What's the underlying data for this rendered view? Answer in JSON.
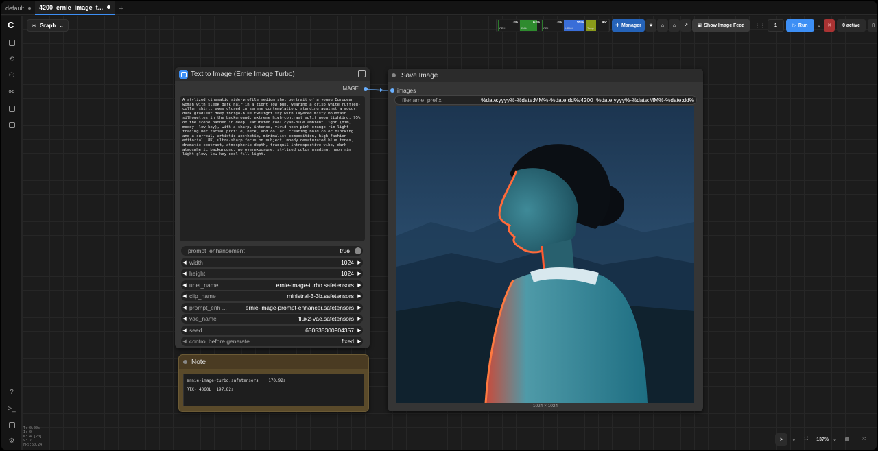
{
  "tabs": [
    {
      "label": "default",
      "active": false
    },
    {
      "label": "4200_ernie_image_t...",
      "active": true
    }
  ],
  "header": {
    "graph_label": "Graph"
  },
  "monitor": [
    {
      "label": "CPU",
      "value": "3%",
      "fill": 0.03,
      "color": "#2c7a2c"
    },
    {
      "label": "RAM",
      "value": "83%",
      "fill": 0.83,
      "color": "#2e8b2e"
    },
    {
      "label": "GPU",
      "value": "3%",
      "fill": 0.03,
      "color": "#2c7a2c"
    },
    {
      "label": "VRAM",
      "value": "95%",
      "fill": 0.95,
      "color": "#3a6ed8"
    },
    {
      "label": "Temp",
      "value": "46°",
      "fill": 0.46,
      "color": "#8a9a1a"
    }
  ],
  "toolbar": {
    "manager_label": "Manager",
    "image_feed_label": "Show Image Feed",
    "queue_count": "1",
    "run_label": "Run",
    "active_label": "0 active"
  },
  "text_node": {
    "title": "Text to Image (Ernie Image Turbo)",
    "output_label": "IMAGE",
    "prompt": "A stylized cinematic side-profile medium shot portrait of a young European woman with sleek dark hair in a tight low bun, wearing a crisp white ruffled-collar shirt, eyes closed in serene contemplation, standing against a moody, dark gradient deep indigo-blue twilight sky with layered misty mountain silhouettes in the background. extreme high-contrast split neon lighting: 95% of the scene bathed in deep, saturated cool cyan-blue ambient light (dim, moody, low-key), with a sharp, intense, vivid neon pink-orange rim light tracing her facial profile, neck, and collar, creating bold color blocking and a surreal, artistic aesthetic, minimalist composition, high-fashion editorial, 8K, ultra-sharp focus on subject, moody desaturated blue tones, dramatic contrast, atmospheric depth, tranquil introspective vibe, dark atmospheric background, no overexposure, stylized color grading, neon rim light glow, low-key cool fill light.",
    "widgets": [
      {
        "name": "prompt_enhancement",
        "value": "true",
        "type": "toggle"
      },
      {
        "name": "width",
        "value": "1024",
        "type": "number"
      },
      {
        "name": "height",
        "value": "1024",
        "type": "number"
      },
      {
        "name": "unet_name",
        "value": "ernie-image-turbo.safetensors",
        "type": "combo"
      },
      {
        "name": "clip_name",
        "value": "ministral-3-3b.safetensors",
        "type": "combo"
      },
      {
        "name": "prompt_enh ...",
        "value": "ernie-image-prompt-enhancer.safetensors",
        "type": "combo"
      },
      {
        "name": "vae_name",
        "value": "flux2-vae.safetensors",
        "type": "combo"
      },
      {
        "name": "seed",
        "value": "630535300904357",
        "type": "number"
      },
      {
        "name": "control before generate",
        "value": "fixed",
        "type": "combo"
      }
    ]
  },
  "note_node": {
    "title": "Note",
    "lines": [
      "ernie-image-turbo.safetensors    170.92s",
      "RTX- 4060L  197.82s"
    ]
  },
  "save_node": {
    "title": "Save Image",
    "input_label": "images",
    "prefix_label": "filename_prefix",
    "prefix_value": "%date:yyyy%-%date:MM%-%date:dd%/4200_%date:yyyy%-%date:MM%-%date:dd%",
    "size_caption": "1024 × 1024"
  },
  "stats": [
    "T: 0.00s",
    "I: 0",
    "N: 4 [20]",
    "V: 7",
    "FPS:60.24"
  ],
  "zoom": {
    "value": "137%"
  }
}
